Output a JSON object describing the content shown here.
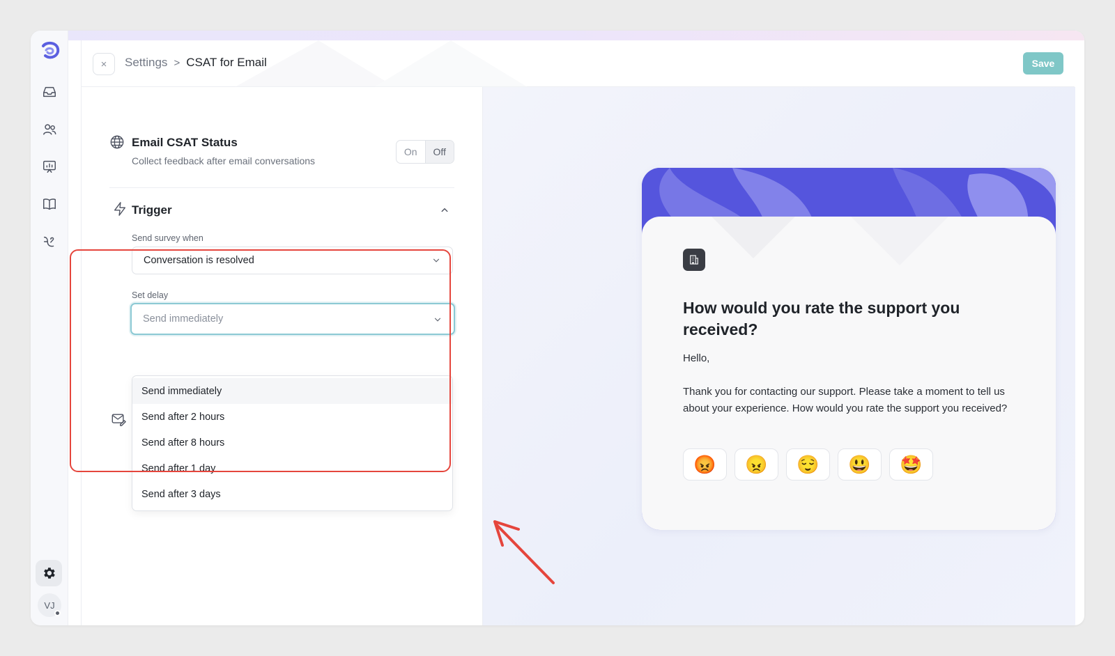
{
  "header": {
    "breadcrumb_root": "Settings",
    "breadcrumb_sep": ">",
    "breadcrumb_current": "CSAT for Email",
    "close_glyph": "×",
    "save_label": "Save"
  },
  "sidebar": {
    "avatar_initials": "VJ",
    "icons": [
      "app-logo-icon",
      "inbox-icon",
      "contacts-icon",
      "reports-icon",
      "knowledge-base-icon",
      "workflow-icon",
      "settings-gear-icon"
    ]
  },
  "status": {
    "title": "Email CSAT Status",
    "subtitle": "Collect feedback after email conversations",
    "toggle_on": "On",
    "toggle_off": "Off",
    "selected": "Off"
  },
  "trigger": {
    "title": "Trigger",
    "send_when_label": "Send survey when",
    "send_when_value": "Conversation is resolved",
    "delay_label": "Set delay",
    "delay_placeholder": "Send immediately",
    "delay_options": [
      "Send immediately",
      "Send after 2 hours",
      "Send after 8 hours",
      "Send after 1 day",
      "Send after 3 days"
    ]
  },
  "preview": {
    "question": "How would you rate the support you received?",
    "greeting": "Hello,",
    "message": "Thank you for contacting our support. Please take a moment to tell us about your experience. How would you rate the support you received?",
    "ratings": [
      "😡",
      "😠",
      "😌",
      "😃",
      "🤩"
    ]
  },
  "colors": {
    "accent_save": "#7fc7c7",
    "card_banner": "#5555dd",
    "annotation": "#e5453c",
    "focus_ring": "#8cc9d4"
  }
}
